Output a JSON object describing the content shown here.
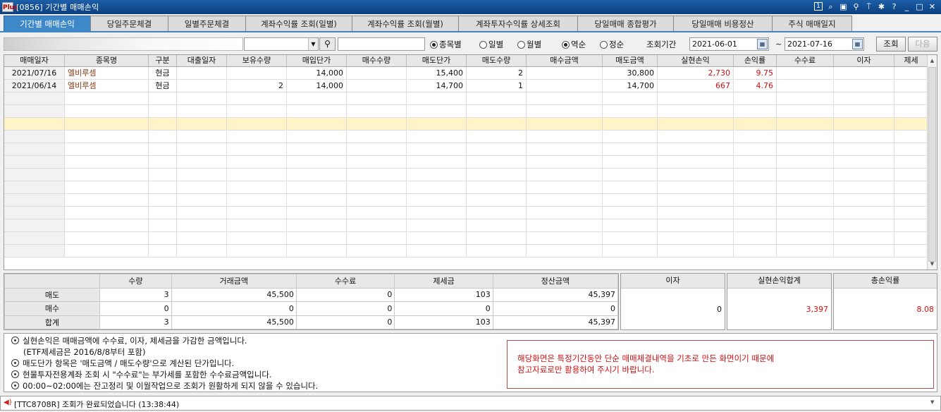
{
  "window": {
    "title": "[0856] 기간별 매매손익",
    "logo": "Plus",
    "page_num": "1"
  },
  "tabs": [
    "기간별 매매손익",
    "당일주문체결",
    "일별주문체결",
    "계좌수익률 조회(일별)",
    "계좌수익률 조회(월별)",
    "계좌투자수익률 상세조회",
    "당일매매 종합평가",
    "당일매매 비용정산",
    "주식 매매일지"
  ],
  "filter": {
    "radio_group1": [
      {
        "label": "종목별",
        "checked": true
      },
      {
        "label": "일별",
        "checked": false
      },
      {
        "label": "월별",
        "checked": false
      }
    ],
    "radio_group2": [
      {
        "label": "역순",
        "checked": true
      },
      {
        "label": "정순",
        "checked": false
      }
    ],
    "period_label": "조회기간",
    "date_from": "2021-06-01",
    "tilde": "~",
    "date_to": "2021-07-16",
    "query_button": "조회",
    "next_button": "다음"
  },
  "grid": {
    "columns": [
      "매매일자",
      "종목명",
      "구분",
      "대출일자",
      "보유수량",
      "매입단가",
      "매수수량",
      "매도단가",
      "매도수량",
      "매수금액",
      "매도금액",
      "실현손익",
      "손익률",
      "수수료",
      "이자",
      "제세"
    ],
    "rows": [
      [
        "2021/07/16",
        "엘비루셈",
        "현금",
        "",
        "",
        "14,000",
        "",
        "15,400",
        "2",
        "",
        "30,800",
        "2,730",
        "9.75",
        "",
        ""
      ],
      [
        "2021/06/14",
        "엘비루셈",
        "현금",
        "",
        "2",
        "14,000",
        "",
        "14,700",
        "1",
        "",
        "14,700",
        "667",
        "4.76",
        "",
        ""
      ]
    ]
  },
  "summary": {
    "headers": [
      "수량",
      "거래금액",
      "수수료",
      "제세금",
      "정산금액"
    ],
    "rows": [
      {
        "label": "매도",
        "values": [
          "3",
          "45,500",
          "0",
          "103",
          "45,397"
        ]
      },
      {
        "label": "매수",
        "values": [
          "0",
          "0",
          "0",
          "0",
          "0"
        ]
      },
      {
        "label": "합계",
        "values": [
          "3",
          "45,500",
          "0",
          "103",
          "45,397"
        ]
      }
    ],
    "interest_label": "이자",
    "interest_value": "0",
    "realized_label": "실현손익합계",
    "realized_value": "3,397",
    "total_rate_label": "총손익률",
    "total_rate_value": "8.08"
  },
  "notes": [
    "실현손익은 매매금액에 수수료, 이자, 제세금을 가감한 금액입니다.",
    "(ETF제세금은 2016/8/8부터 포함)",
    "매도단가 항목은 '매도금액 / 매도수량'으로 계산된 단가입니다.",
    "현물투자전용계좌 조회 시 \"수수료\"는 부가세를 포함한 수수료금액입니다.",
    "00:00~02:00에는 잔고정리 및 이월작업으로 조회가 원활하게 되지 않을 수 있습니다."
  ],
  "warning": [
    "해당화면은 특정기간동안 단순 매매체결내역을 기초로 만든 화면이기 때문에",
    "참고자료로만 활용하여 주시기 바랍니다."
  ],
  "status": {
    "message": "[TTC8708R] 조회가 완료되었습니다 (13:38:44)"
  },
  "colors": {
    "title_bar": "#0b3f7e",
    "tab_active": "#3f88c8",
    "profit": "#d01010",
    "stock_name": "#8a3b16",
    "selected_row": "#fff3c8"
  }
}
